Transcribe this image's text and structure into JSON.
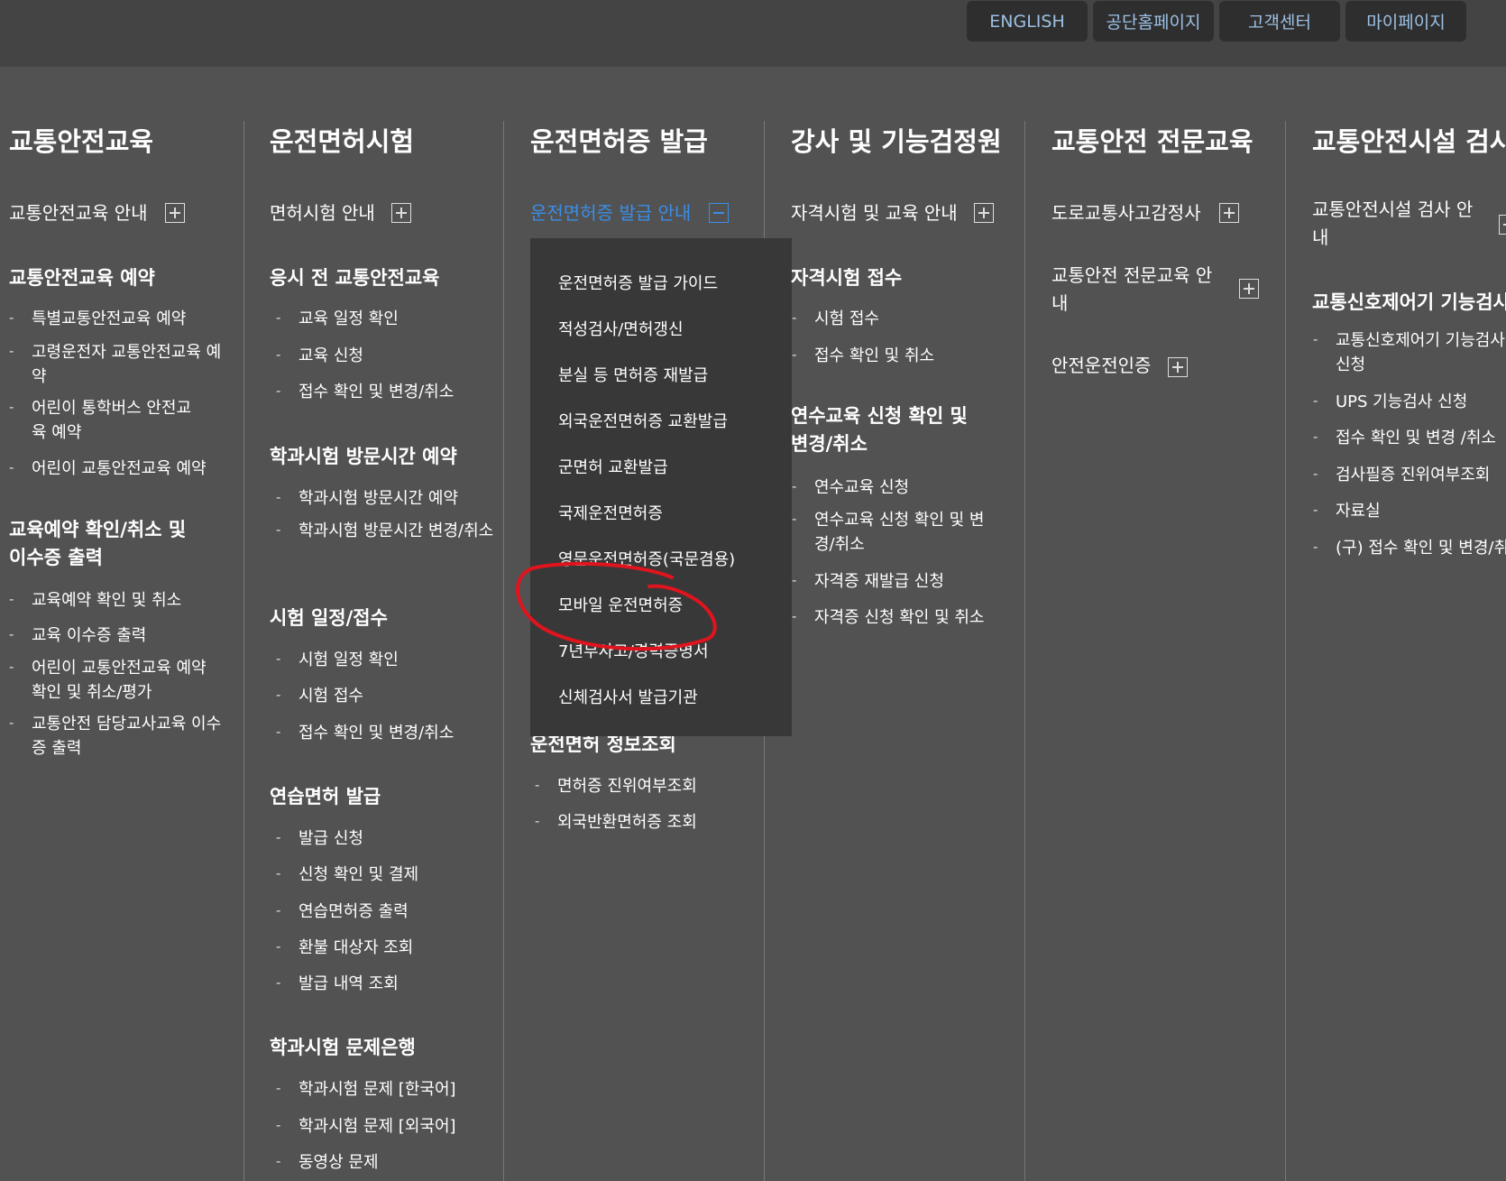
{
  "header": {
    "buttons": [
      "ENGLISH",
      "공단홈페이지",
      "고객센터",
      "마이페이지"
    ]
  },
  "columns": [
    {
      "title": "교통안전교육",
      "sections": [
        {
          "label": "교통안전교육 안내"
        },
        {
          "label": "교통안전교육 예약",
          "items": [
            "특별교통안전교육 예약",
            "고령운전자 교통안전교육 예약",
            "어린이 통학버스 안전교육 예약",
            "어린이 교통안전교육 예약"
          ]
        },
        {
          "label": "교육예약 확인/취소 및 이수증 출력",
          "items": [
            "교육예약 확인 및 취소",
            "교육 이수증 출력",
            "어린이 교통안전교육 예약 확인 및 취소/평가",
            "교통안전 담당교사교육 이수증 출력"
          ]
        }
      ]
    },
    {
      "title": "운전면허시험",
      "sections": [
        {
          "label": "면허시험 안내"
        },
        {
          "label": "응시 전 교통안전교육",
          "items": [
            "교육 일정 확인",
            "교육 신청",
            "접수 확인 및 변경/취소"
          ]
        },
        {
          "label": "학과시험 방문시간 예약",
          "items": [
            "학과시험 방문시간 예약",
            "학과시험 방문시간 변경/취소"
          ]
        },
        {
          "label": "시험 일정/접수",
          "items": [
            "시험 일정 확인",
            "시험 접수",
            "접수 확인 및 변경/취소"
          ]
        },
        {
          "label": "연습면허 발급",
          "items": [
            "발급 신청",
            "신청 확인 및 결제",
            "연습면허증 출력",
            "환불 대상자 조회",
            "발급 내역 조회"
          ]
        },
        {
          "label": "학과시험 문제은행",
          "items": [
            "학과시험 문제 [한국어]",
            "학과시험 문제 [외국어]",
            "동영상 문제"
          ]
        }
      ]
    },
    {
      "title": "운전면허증 발급",
      "sections": [
        {
          "label": "운전면허증 발급 안내"
        },
        {
          "label": "운전면허 정보조회",
          "items": [
            "면허증 진위여부조회",
            "외국반환면허증 조회"
          ]
        }
      ],
      "dropdown": [
        "운전면허증 발급 가이드",
        "적성검사/면허갱신",
        "분실 등 면허증 재발급",
        "외국운전면허증 교환발급",
        "군면허 교환발급",
        "국제운전면허증",
        "영문운전면허증(국문겸용)",
        "모바일 운전면허증",
        "7년무사고/경력증명서",
        "신체검사서 발급기관"
      ]
    },
    {
      "title": "강사 및 기능검정원",
      "sections": [
        {
          "label": "자격시험 및 교육 안내"
        },
        {
          "label": "자격시험 접수",
          "items": [
            "시험 접수",
            "접수 확인 및 취소"
          ]
        },
        {
          "label": "연수교육 신청 확인 및 변경/취소",
          "items": [
            "연수교육 신청",
            "연수교육 신청 확인 및 변경/취소",
            "자격증 재발급 신청",
            "자격증 신청 확인 및 취소"
          ]
        }
      ]
    },
    {
      "title": "교통안전 전문교육",
      "sections": [
        {
          "label": "도로교통사고감정사"
        },
        {
          "label": "교통안전 전문교육 안내"
        },
        {
          "label": "안전운전인증"
        }
      ]
    },
    {
      "title": "교통안전시설 검사",
      "sections": [
        {
          "label": "교통안전시설 검사 안내"
        },
        {
          "label": "교통신호제어기 기능검사",
          "items": [
            "교통신호제어기 기능검사 신청",
            "UPS 기능검사 신청",
            "접수 확인 및 변경 /취소",
            "검사필증 진위여부조회",
            "자료실",
            "(구) 접수 확인 및 변경/취소"
          ]
        }
      ]
    }
  ],
  "colors": {
    "background": "#525252",
    "topbar": "#444444",
    "accent": "#3a8ee6",
    "dropdown": "#383838",
    "annotation": "#e0141e"
  },
  "icons": [
    "plus-icon",
    "minus-icon"
  ]
}
